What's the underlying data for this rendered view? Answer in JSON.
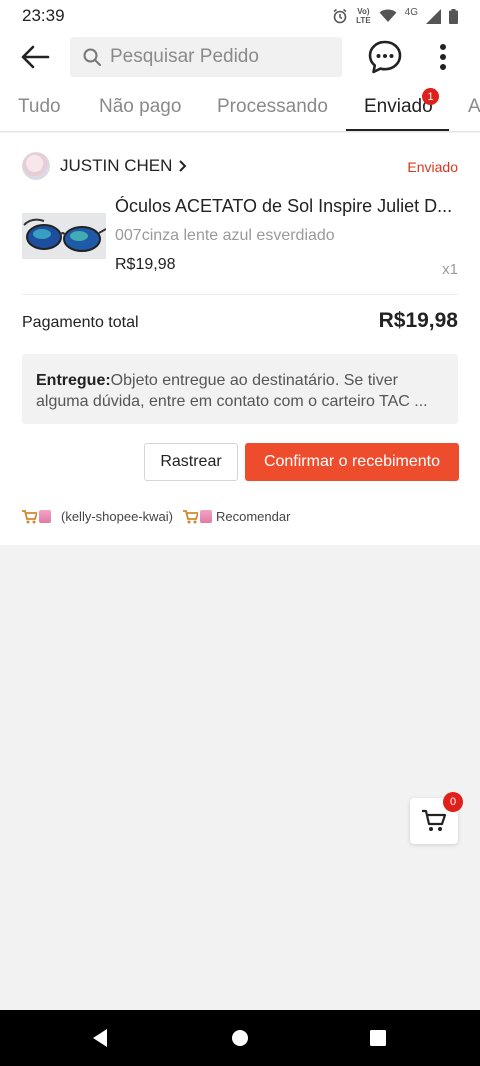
{
  "status_bar": {
    "time": "23:39",
    "network_label_top": "Vo)",
    "network_label_bottom": "LTE",
    "network_type": "4G",
    "icons": [
      "alarm-icon",
      "volte-icon",
      "wifi-icon",
      "signal-icon",
      "battery-icon"
    ]
  },
  "header": {
    "back_icon": "arrow-left-icon",
    "search_placeholder": "Pesquisar Pedido",
    "chat_icon": "chat-bubble-icon",
    "more_icon": "more-vertical-icon"
  },
  "tabs": [
    {
      "label": "Tudo",
      "active": false
    },
    {
      "label": "Não pago",
      "active": false
    },
    {
      "label": "Processando",
      "active": false
    },
    {
      "label": "Enviado",
      "active": true,
      "badge": "1"
    },
    {
      "label": "A",
      "active": false
    }
  ],
  "order": {
    "shop_name": "JUSTIN CHEN",
    "status": "Enviado",
    "product": {
      "title": "Óculos ACETATO de Sol Inspire Juliet D...",
      "variant": "007cinza lente azul esverdiado",
      "price": "R$19,98",
      "quantity": "x1"
    },
    "total_label": "Pagamento total",
    "total_value": "R$19,98",
    "delivery_label": "Entregue:",
    "delivery_text": "Objeto entregue ao destinatário. Se tiver alguma dúvida, entre em contato com o carteiro TAC ...",
    "track_button": "Rastrear",
    "confirm_button": "Confirmar o recebimento",
    "affiliate_text": "(kelly-shopee-kwai)",
    "recommend_text": "Recomendar"
  },
  "floating_cart": {
    "count": "0"
  },
  "colors": {
    "accent": "#ee4d2d",
    "status_red": "#d9361e",
    "badge_red": "#e0201a"
  }
}
